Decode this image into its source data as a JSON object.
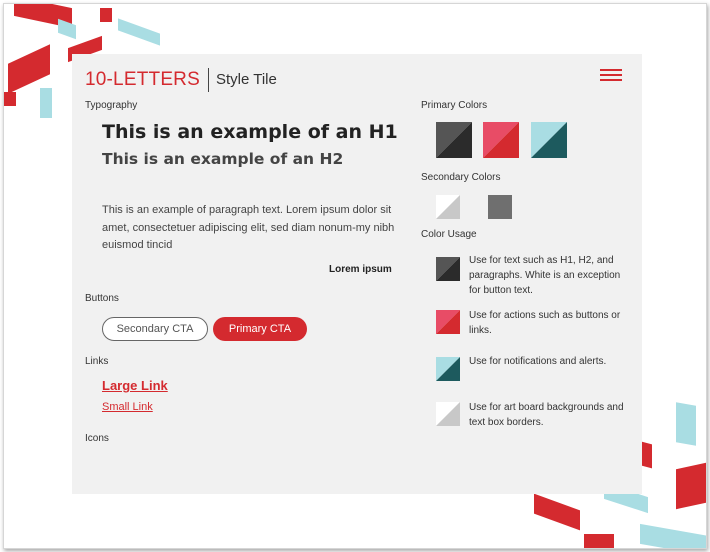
{
  "header": {
    "logo": "10-LETTERS",
    "subtitle": "Style Tile",
    "menu_icon": "hamburger-menu-icon"
  },
  "typography": {
    "label": "Typography",
    "h1": "This is an example of an H1",
    "h2": "This is an example of an H2",
    "paragraph": "This is an example of paragraph text. Lorem ipsum dolor sit amet, consectetuer adipiscing elit, sed diam nonum-my nibh euismod tincid",
    "bold_text": "Lorem ipsum"
  },
  "buttons": {
    "label": "Buttons",
    "secondary": "Secondary CTA",
    "primary": "Primary CTA"
  },
  "links": {
    "label": "Links",
    "large": "Large Link",
    "small": "Small Link"
  },
  "icons": {
    "label": "Icons"
  },
  "colors": {
    "primary_label": "Primary Colors",
    "secondary_label": "Secondary Colors",
    "usage_label": "Color Usage",
    "primary": [
      {
        "name": "dark-gray",
        "light": "#555555",
        "dark": "#2b2b2b"
      },
      {
        "name": "red",
        "light": "#e84c66",
        "dark": "#d42a2f"
      },
      {
        "name": "teal",
        "light": "#a9dde3",
        "dark": "#1d5a5e"
      }
    ],
    "secondary": [
      {
        "name": "light-gray",
        "light": "#ffffff",
        "dark": "#c8c8c8"
      },
      {
        "name": "mid-gray",
        "light": "#7a7a7a",
        "dark": "#6a6a6a"
      }
    ],
    "usage": [
      {
        "text": "Use for text such as H1, H2, and paragraphs. White is an exception for button text."
      },
      {
        "text": "Use for actions such as buttons or links."
      },
      {
        "text": "Use for notifications and alerts."
      },
      {
        "text": "Use for art board backgrounds and text box borders."
      }
    ]
  },
  "accent_colors": {
    "brand_red": "#d42a2f",
    "accent_teal": "#a9dde3",
    "panel_bg": "#f1f1f1"
  }
}
